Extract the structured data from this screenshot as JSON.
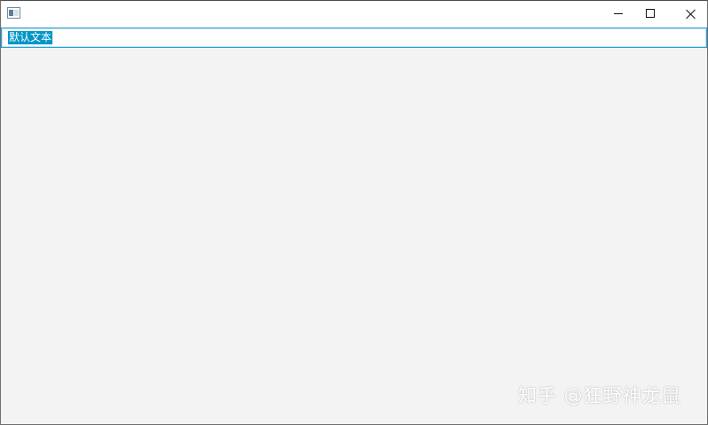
{
  "window": {
    "icon": "app-window-icon",
    "controls": {
      "minimize_icon": "minimize-icon",
      "maximize_icon": "maximize-icon",
      "close_icon": "close-icon"
    }
  },
  "text_field": {
    "value": "默认文本",
    "selected": true,
    "selection_color": "#0096c8",
    "focus_border_color": "#2a9fd6"
  },
  "watermark": {
    "text": "知乎 @狂野神龙鼠"
  },
  "colors": {
    "window_background": "#f3f3f3",
    "titlebar_background": "#ffffff"
  }
}
